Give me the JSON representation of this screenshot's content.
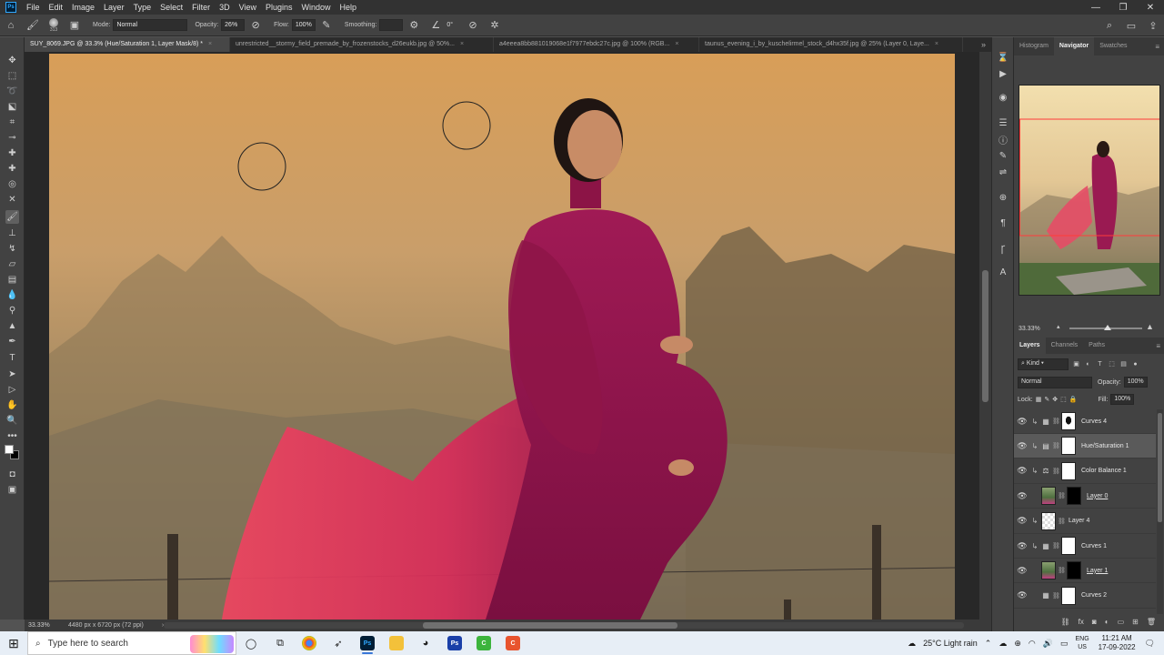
{
  "menubar": {
    "logo": "Ps",
    "items": [
      "File",
      "Edit",
      "Image",
      "Layer",
      "Type",
      "Select",
      "Filter",
      "3D",
      "View",
      "Plugins",
      "Window",
      "Help"
    ]
  },
  "options": {
    "brush_size": "313",
    "mode_label": "Mode:",
    "mode_value": "Normal",
    "opacity_label": "Opacity:",
    "opacity_value": "26%",
    "flow_label": "Flow:",
    "flow_value": "100%",
    "smoothing_label": "Smoothing:",
    "smoothing_value": "",
    "angle_value": "0°"
  },
  "tabs": [
    {
      "label": "SUY_8069.JPG @ 33.3% (Hue/Saturation 1, Layer Mask/8) *",
      "active": true
    },
    {
      "label": "unrestricted__stormy_field_premade_by_frozenstocks_d26eukb.jpg @ 50%...",
      "active": false
    },
    {
      "label": "a4eeea8bb881019068e1f7977ebdc27c.jpg @ 100% (RGB...",
      "active": false
    },
    {
      "label": "taunus_evening_i_by_kuschelirmel_stock_d4hx35f.jpg @ 25% (Layer 0, Laye...",
      "active": false
    }
  ],
  "status": {
    "zoom": "33.33%",
    "doc_size": "4480 px x 6720 px (72 ppi)"
  },
  "panels": {
    "top_tabs": [
      "Histogram",
      "Navigator",
      "Swatches"
    ],
    "navigator_zoom": "33.33%",
    "layer_tabs": [
      "Layers",
      "Channels",
      "Paths"
    ],
    "kind_label": "Kind",
    "blend_mode": "Normal",
    "opacity_label": "Opacity:",
    "opacity_value": "100%",
    "lock_label": "Lock:",
    "fill_label": "Fill:",
    "fill_value": "100%"
  },
  "layers": [
    {
      "name": "Curves 4",
      "type": "curves",
      "mask": "curvemask",
      "clipped": true,
      "selected": false,
      "underline": false
    },
    {
      "name": "Hue/Saturation 1",
      "type": "huesat",
      "mask": "white",
      "clipped": true,
      "selected": true,
      "underline": false
    },
    {
      "name": "Color Balance 1",
      "type": "colorbalance",
      "mask": "white",
      "clipped": true,
      "selected": false,
      "underline": false
    },
    {
      "name": "Layer 0",
      "type": "pixel",
      "mask": "black",
      "clipped": false,
      "selected": false,
      "underline": true
    },
    {
      "name": "Layer 4",
      "type": "pixel",
      "mask": "checker",
      "clipped": true,
      "selected": false,
      "underline": false
    },
    {
      "name": "Curves 1",
      "type": "curves",
      "mask": "white",
      "clipped": true,
      "selected": false,
      "underline": false
    },
    {
      "name": "Layer 1",
      "type": "pixel",
      "mask": "black",
      "clipped": false,
      "selected": false,
      "underline": true
    },
    {
      "name": "Curves 2",
      "type": "curves",
      "mask": "white",
      "clipped": false,
      "selected": false,
      "underline": false
    }
  ],
  "taskbar": {
    "search_placeholder": "Type here to search",
    "weather": "25°C  Light rain",
    "lang_top": "ENG",
    "lang_bottom": "US",
    "time": "11:21 AM",
    "date": "17-09-2022"
  },
  "colors": {
    "ps_bg": "#535353",
    "panel": "#424242",
    "accent_nav": "#ff3b3b",
    "selected_layer": "#5a5a5a"
  }
}
